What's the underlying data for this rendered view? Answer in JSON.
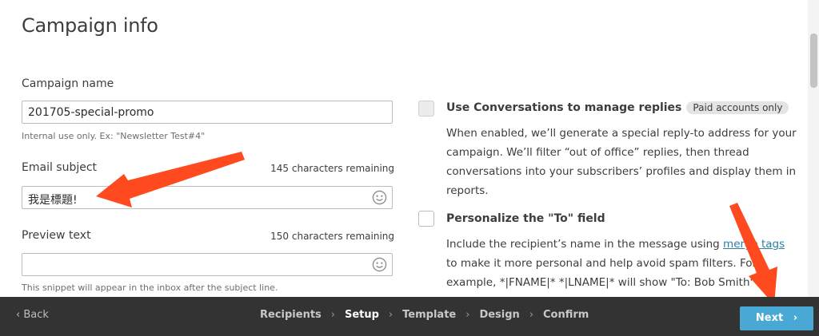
{
  "page_title": "Campaign info",
  "campaign_name": {
    "label": "Campaign name",
    "value": "201705-special-promo",
    "hint": "Internal use only. Ex: \"Newsletter Test#4\""
  },
  "email_subject": {
    "label": "Email subject",
    "remaining": "145 characters remaining",
    "value": "我是標題!"
  },
  "preview_text": {
    "label": "Preview text",
    "remaining": "150 characters remaining",
    "value": "",
    "hint": "This snippet will appear in the inbox after the subject line."
  },
  "conversations": {
    "label": "Use Conversations to manage replies",
    "badge": "Paid accounts only",
    "description": "When enabled, we’ll generate a special reply-to address for your campaign. We’ll filter “out of office” replies, then thread conversations into your subscribers’ profiles and display them in reports."
  },
  "personalize": {
    "label": "Personalize the \"To\" field",
    "desc_part1": "Include the recipient’s name in the message using ",
    "link_text": "merge tags",
    "desc_part2": " to make it more personal and help avoid spam filters. For example, *|FNAME|* *|LNAME|* will show \"To: Bob Smith\" in"
  },
  "footer": {
    "back_label": "Back",
    "steps": [
      "Recipients",
      "Setup",
      "Template",
      "Design",
      "Confirm"
    ],
    "active_step": "Setup",
    "next_label": "Next"
  },
  "colors": {
    "footer_bg": "#333333",
    "next_button": "#4aa8d4",
    "annotation_arrow": "#ff4a1f",
    "link": "#2a7fa3"
  },
  "icons": [
    "smiley-icon",
    "chevron-left-icon",
    "chevron-right-icon"
  ]
}
